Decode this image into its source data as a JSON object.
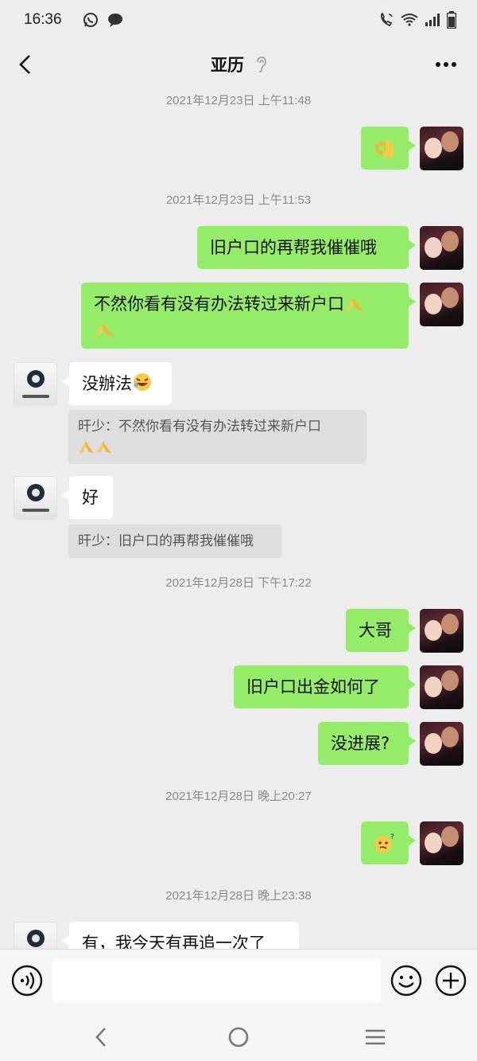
{
  "status": {
    "time": "16:36"
  },
  "header": {
    "title": "亚历"
  },
  "messages": {
    "ts1": "2021年12月23日 上午11:48",
    "ts2": "2021年12月23日 上午11:53",
    "m2": "旧户口的再帮我催催哦",
    "m3": "不然你看有没有办法转过来新户口",
    "m4": "没辦法",
    "q4": "旰少：不然你看有没有办法转过来新户口",
    "m5": "好",
    "q5": "旰少：旧户口的再帮我催催哦",
    "ts3": "2021年12月28日 下午17:22",
    "m6": "大哥",
    "m7": "旧户口出金如何了",
    "m8": "没进展?",
    "ts4": "2021年12月28日 晚上20:27",
    "ts5": "2021年12月28日 晚上23:38",
    "m10": "有，我今天有再追一次了"
  },
  "icons": {
    "ok_hand": "ok-hand-emoji",
    "pray": "folded-hands-emoji",
    "laugh": "rolling-laughing-emoji",
    "confused": "confused-face-emoji"
  },
  "colors": {
    "my_bubble": "#95ec69",
    "other_bubble": "#ffffff",
    "background": "#ededed"
  }
}
